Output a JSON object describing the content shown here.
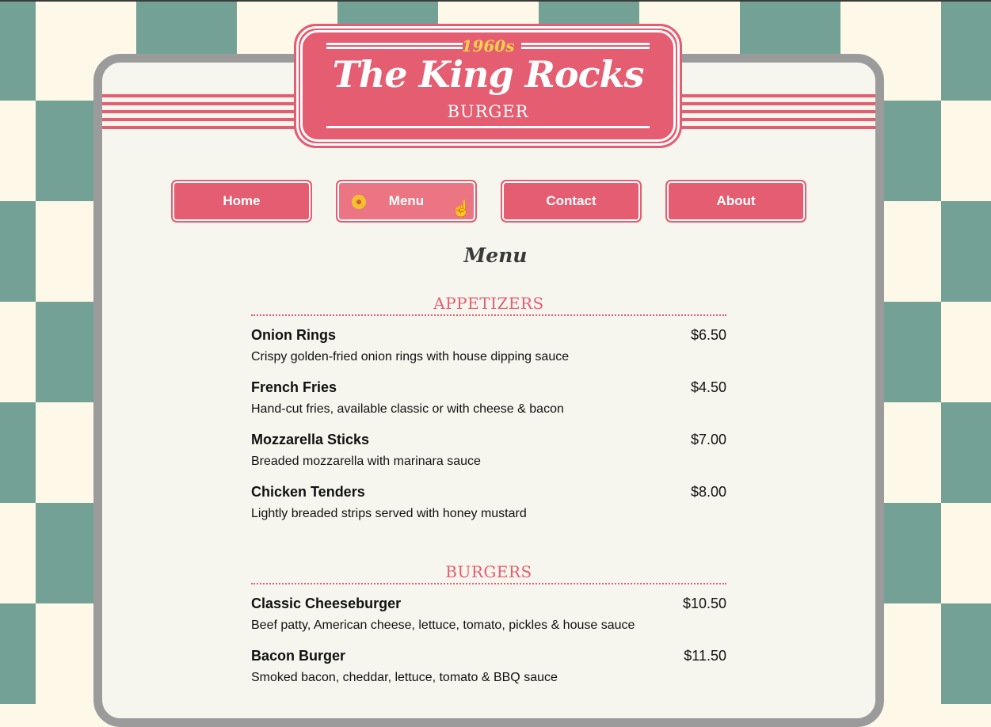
{
  "colors": {
    "accent": "#e55d70",
    "checker": "#74a195",
    "cream": "#fdf8e8"
  },
  "header": {
    "year": "1960s",
    "title": "The King Rocks",
    "subtitle": "BURGER"
  },
  "nav": {
    "items": [
      {
        "label": "Home"
      },
      {
        "label": "Menu",
        "active": true,
        "icon": "disc-icon"
      },
      {
        "label": "Contact"
      },
      {
        "label": "About"
      }
    ]
  },
  "page": {
    "title": "Menu"
  },
  "sections": [
    {
      "title": "APPETIZERS",
      "items": [
        {
          "name": "Onion Rings",
          "price": "$6.50",
          "desc": "Crispy golden-fried onion rings with house dipping sauce"
        },
        {
          "name": "French Fries",
          "price": "$4.50",
          "desc": "Hand-cut fries, available classic or with cheese & bacon"
        },
        {
          "name": "Mozzarella Sticks",
          "price": "$7.00",
          "desc": "Breaded mozzarella with marinara sauce"
        },
        {
          "name": "Chicken Tenders",
          "price": "$8.00",
          "desc": "Lightly breaded strips served with honey mustard"
        }
      ]
    },
    {
      "title": "BURGERS",
      "items": [
        {
          "name": "Classic Cheeseburger",
          "price": "$10.50",
          "desc": "Beef patty, American cheese, lettuce, tomato, pickles & house sauce"
        },
        {
          "name": "Bacon Burger",
          "price": "$11.50",
          "desc": "Smoked bacon, cheddar, lettuce, tomato & BBQ sauce"
        }
      ]
    }
  ]
}
